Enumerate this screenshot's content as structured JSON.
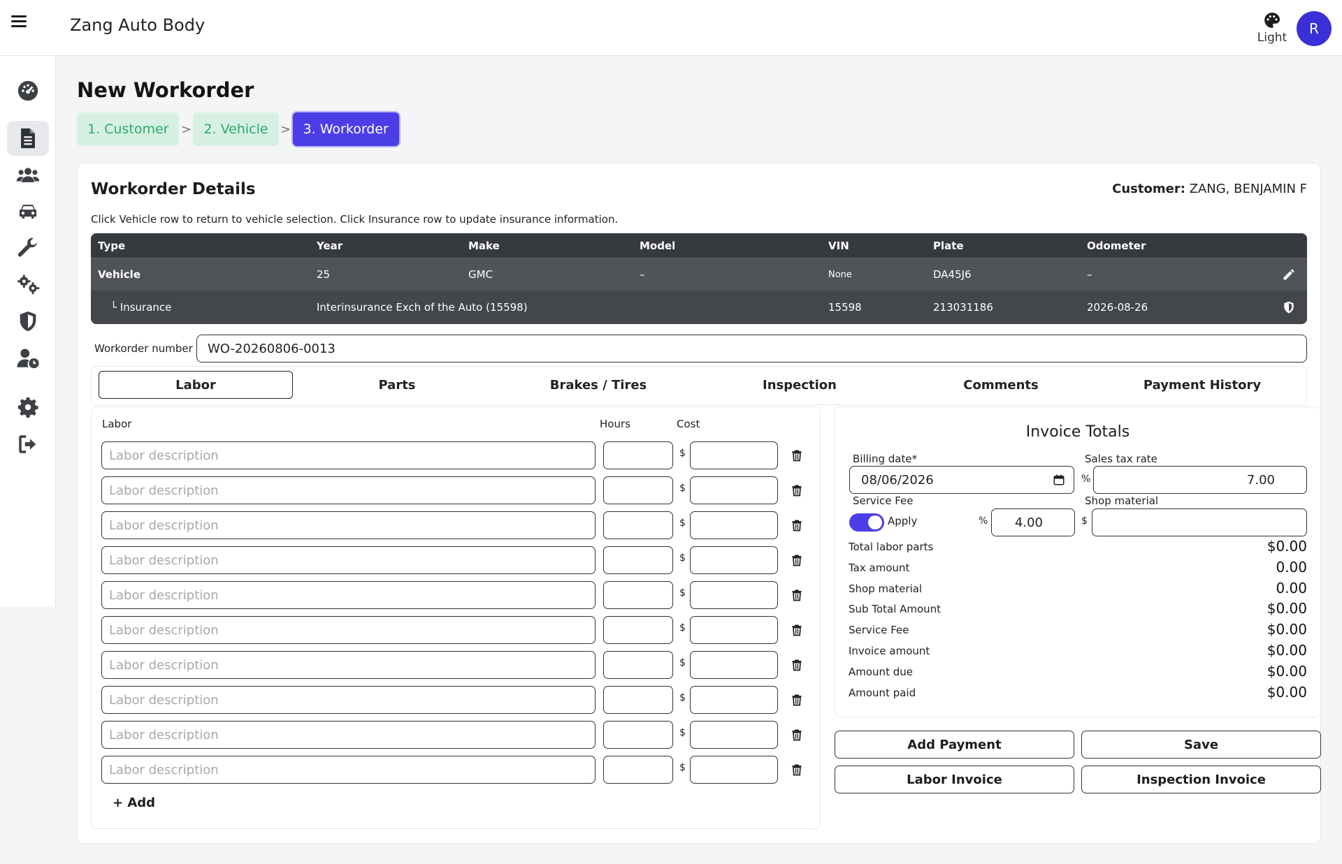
{
  "app": {
    "title": "Zang Auto Body"
  },
  "header": {
    "theme_label": "Light",
    "avatar_initial": "R"
  },
  "sidebar": {
    "items": [
      {
        "name": "dashboard",
        "icon": "gauge-icon"
      },
      {
        "name": "workorders",
        "icon": "document-icon",
        "active": true
      },
      {
        "name": "customers",
        "icon": "users-icon"
      },
      {
        "name": "vehicles",
        "icon": "car-icon"
      },
      {
        "name": "tools",
        "icon": "wrench-icon"
      },
      {
        "name": "services",
        "icon": "gears-icon"
      },
      {
        "name": "insurance",
        "icon": "shield-icon"
      },
      {
        "name": "accounts",
        "icon": "user-clock-icon"
      },
      {
        "name": "settings",
        "icon": "gear-icon"
      },
      {
        "name": "logout",
        "icon": "logout-icon"
      }
    ]
  },
  "page": {
    "title": "New Workorder"
  },
  "stepper": {
    "steps": [
      {
        "label": "1. Customer",
        "state": "done"
      },
      {
        "label": "2. Vehicle",
        "state": "done"
      },
      {
        "label": "3. Workorder",
        "state": "active"
      }
    ],
    "separator": ">"
  },
  "details": {
    "title": "Workorder Details",
    "customer_label": "Customer:",
    "customer_value": "ZANG, BENJAMIN F",
    "hint": "Click Vehicle row to return to vehicle selection. Click Insurance row to update insurance information."
  },
  "vehicle_table": {
    "headers": [
      "Type",
      "Year",
      "Make",
      "Model",
      "VIN",
      "Plate",
      "Odometer"
    ],
    "vehicle_row": [
      "Vehicle",
      "25",
      "GMC",
      "–",
      "None",
      "DA45J6",
      "–"
    ],
    "insurance_row": [
      "└ Insurance",
      "Interinsurance Exch of the Auto (15598)",
      "",
      "",
      "15598",
      "213031186",
      "2026-08-26"
    ]
  },
  "workorder": {
    "label": "Workorder number",
    "value": "WO-20260806-0013"
  },
  "tabs": [
    "Labor",
    "Parts",
    "Brakes / Tires",
    "Inspection",
    "Comments",
    "Payment History"
  ],
  "labor": {
    "col_labor": "Labor",
    "col_hours": "Hours",
    "col_cost": "Cost",
    "placeholder": "Labor description",
    "currency": "$",
    "add_label": "+ Add"
  },
  "invoice": {
    "title": "Invoice Totals",
    "billing_label": "Billing date*",
    "billing_value": "08/06/2026",
    "tax_label": "Sales tax rate",
    "tax_value": "7.00",
    "percent": "%",
    "fee_label": "Service Fee",
    "apply_label": "Apply",
    "fee_value": "4.00",
    "shop_label": "Shop material",
    "currency": "$",
    "totals": [
      {
        "label": "Total labor parts",
        "value": "$0.00"
      },
      {
        "label": "Tax amount",
        "value": "0.00"
      },
      {
        "label": "Shop material",
        "value": "0.00"
      },
      {
        "label": "Sub Total Amount",
        "value": "$0.00"
      },
      {
        "label": "Service Fee",
        "value": "$0.00"
      },
      {
        "label": "Invoice amount",
        "value": "$0.00"
      },
      {
        "label": "Amount due",
        "value": "$0.00"
      },
      {
        "label": "Amount paid",
        "value": "$0.00"
      }
    ]
  },
  "actions": {
    "add_payment": "Add Payment",
    "save": "Save",
    "labor_invoice": "Labor Invoice",
    "inspection_invoice": "Inspection Invoice"
  },
  "colors": {
    "accent": "#4b3ee6",
    "done_bg": "#d6f1e3",
    "done_text": "#2ea86a",
    "table_bg": "#43464b"
  }
}
